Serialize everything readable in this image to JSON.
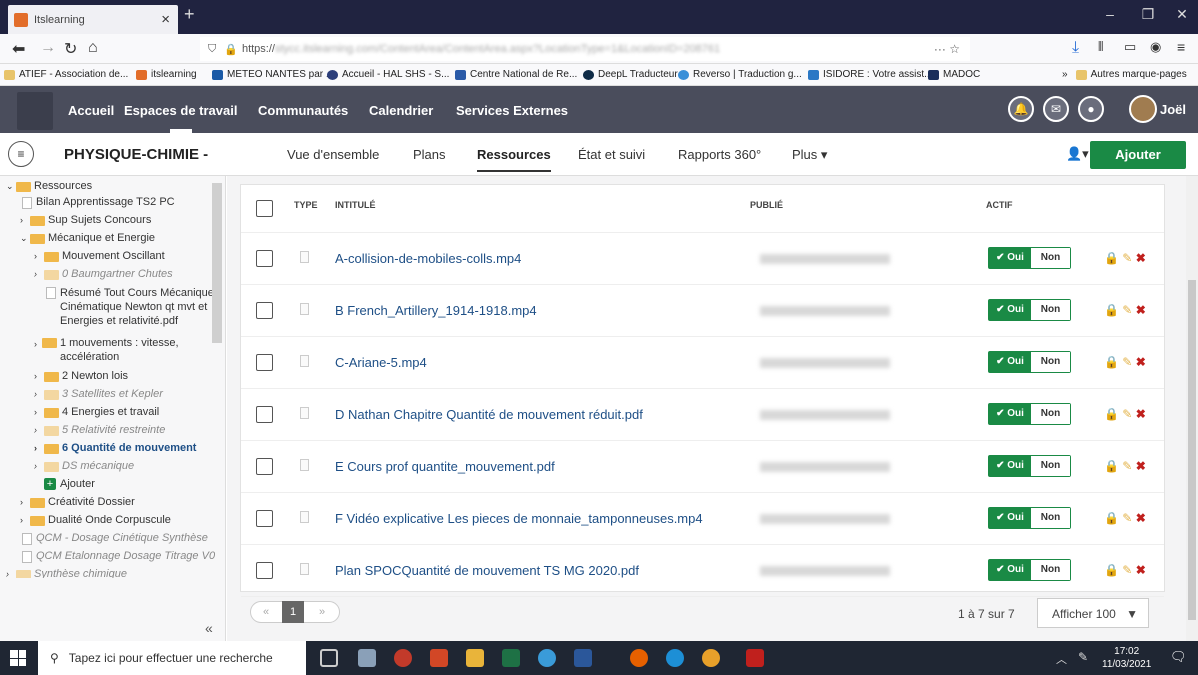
{
  "browser": {
    "tab_title": "Itslearning",
    "url_prefix": "https://",
    "url_rest": "stycc.itslearning.com/ContentArea/ContentArea.aspx?LocationType=1&LocationID=208761",
    "url_menu": "··· ☆"
  },
  "bookmarks": [
    "ATIEF - Association de...",
    "itslearning",
    "METEO NANTES par ...",
    "Accueil - HAL SHS - S...",
    "Centre National de Re...",
    "DeepL Traducteur",
    "Reverso | Traduction g...",
    "ISIDORE : Votre assist...",
    "MADOC"
  ],
  "bookmarks_more": "Autres marque-pages",
  "topnav": {
    "home": "Accueil",
    "workspaces": "Espaces de travail",
    "communities": "Communautés",
    "calendar": "Calendrier",
    "external": "Services Externes",
    "username": "Joël"
  },
  "course": {
    "title": "PHYSIQUE-CHIMIE -",
    "tabs": [
      "Vue d'ensemble",
      "Plans",
      "Ressources",
      "État et suivi",
      "Rapports 360°",
      "Plus ▾"
    ],
    "add": "Ajouter"
  },
  "sidebar": {
    "items": [
      "Ressources",
      "Bilan Apprentissage TS2 PC",
      "Sup Sujets Concours",
      "Mécanique et Energie",
      "Mouvement Oscillant",
      "0 Baumgartner Chutes",
      "Résumé Tout Cours Mécanique Cinématique Newton qt mvt et Energies et relativité.pdf",
      "1 mouvements : vitesse, accélération",
      "2 Newton lois",
      "3 Satellites et Kepler",
      "4 Energies et travail",
      "5 Relativité restreinte",
      "6 Quantité de mouvement",
      "DS mécanique",
      "Ajouter",
      "Créativité Dossier",
      "Dualité Onde Corpuscule",
      "QCM - Dosage Cinétique Synthèse",
      "QCM Etalonnage Dosage Titrage V0",
      "Synthèse chimique"
    ]
  },
  "table": {
    "headers": {
      "type": "TYPE",
      "title": "INTITULÉ",
      "published": "PUBLIÉ",
      "active": "ACTIF"
    },
    "rows": [
      {
        "title": "A-collision-de-mobiles-colls.mp4"
      },
      {
        "title": "B French_Artillery_1914-1918.mp4"
      },
      {
        "title": "C-Ariane-5.mp4"
      },
      {
        "title": "D Nathan Chapitre Quantité de mouvement réduit.pdf"
      },
      {
        "title": "E Cours prof quantite_mouvement.pdf"
      },
      {
        "title": "F Vidéo explicative Les pieces de monnaie_tamponneuses.mp4"
      },
      {
        "title": "Plan SPOCQuantité de mouvement TS MG 2020.pdf"
      }
    ],
    "toggle_on": "✔ Oui",
    "toggle_off": "Non"
  },
  "pager": {
    "prev": "«",
    "page": "1",
    "next": "»",
    "count": "1 à 7 sur 7",
    "show": "Afficher 100"
  },
  "taskbar": {
    "search": "Tapez ici pour effectuer une recherche",
    "time": "17:02",
    "date": "11/03/2021"
  }
}
